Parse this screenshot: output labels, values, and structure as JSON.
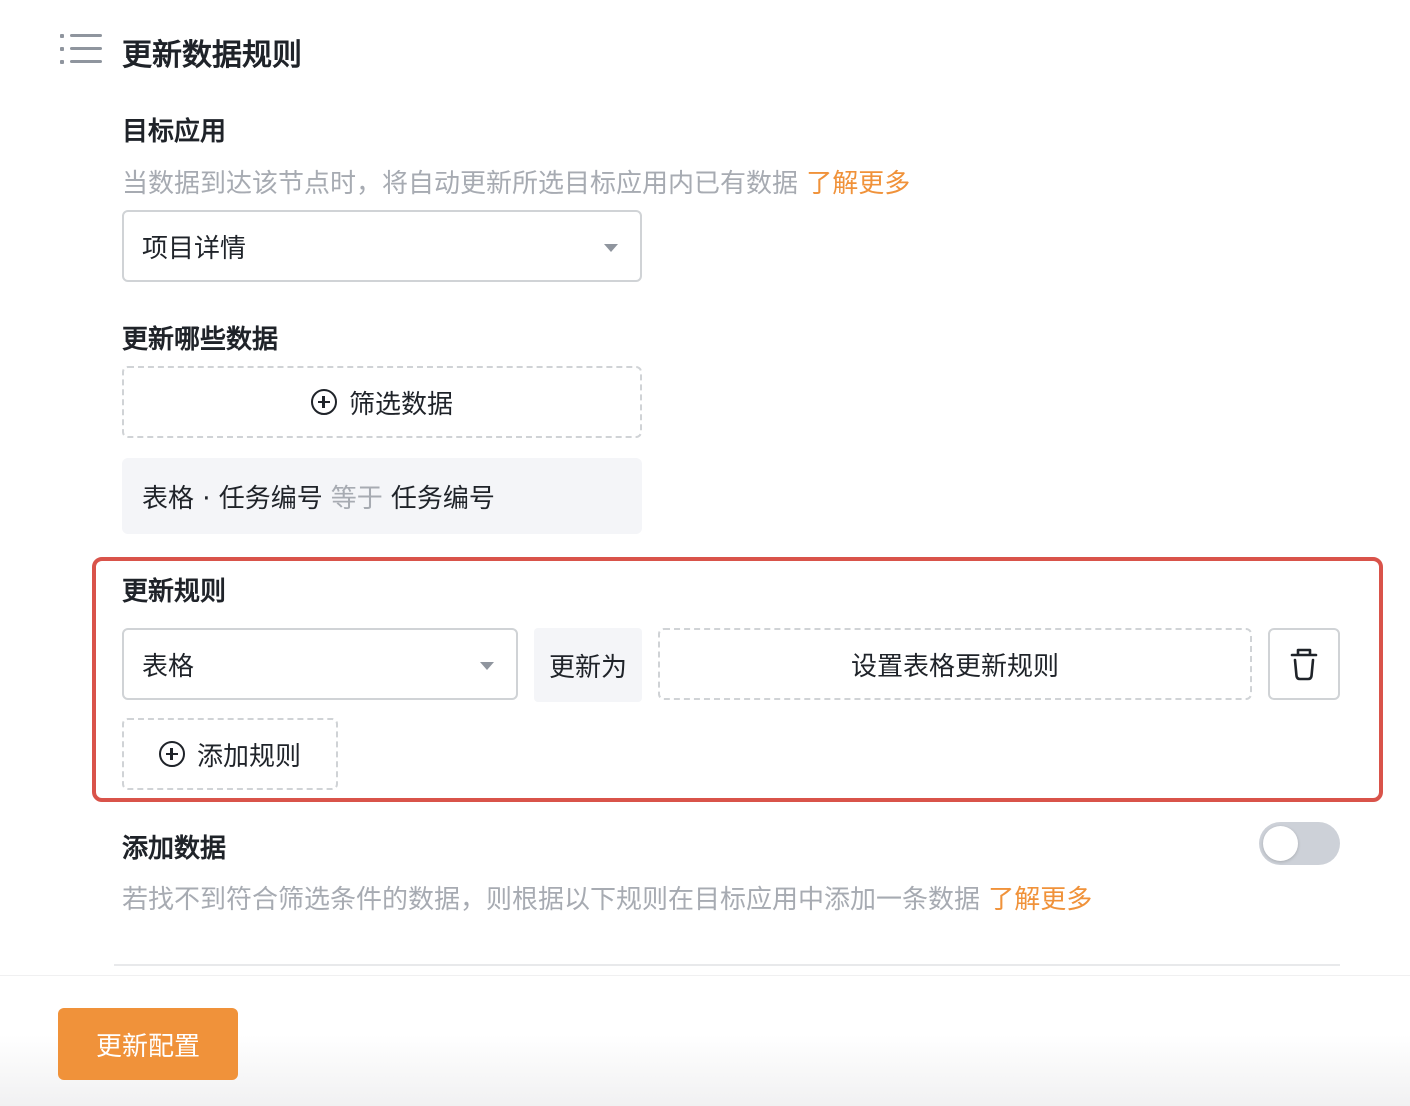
{
  "header": {
    "title": "更新数据规则",
    "icon": "list-icon"
  },
  "target_app": {
    "title": "目标应用",
    "description": "当数据到达该节点时，将自动更新所选目标应用内已有数据",
    "learn_more": "了解更多",
    "selected": "项目详情"
  },
  "which_data": {
    "title": "更新哪些数据",
    "filter_button": "筛选数据",
    "condition": {
      "field": "表格 · 任务编号",
      "operator": "等于",
      "value": "任务编号"
    }
  },
  "update_rules": {
    "title": "更新规则",
    "rule": {
      "field": "表格",
      "update_as": "更新为",
      "set_rule_button": "设置表格更新规则",
      "delete_icon": "trash-icon"
    },
    "add_rule_button": "添加规则"
  },
  "add_data": {
    "title": "添加数据",
    "description": "若找不到符合筛选条件的数据，则根据以下规则在目标应用中添加一条数据",
    "learn_more": "了解更多",
    "enabled": false
  },
  "footer": {
    "submit_button": "更新配置"
  },
  "colors": {
    "accent": "#f0923a",
    "highlight_border": "#d9534a",
    "muted_text": "#a7abb2"
  }
}
